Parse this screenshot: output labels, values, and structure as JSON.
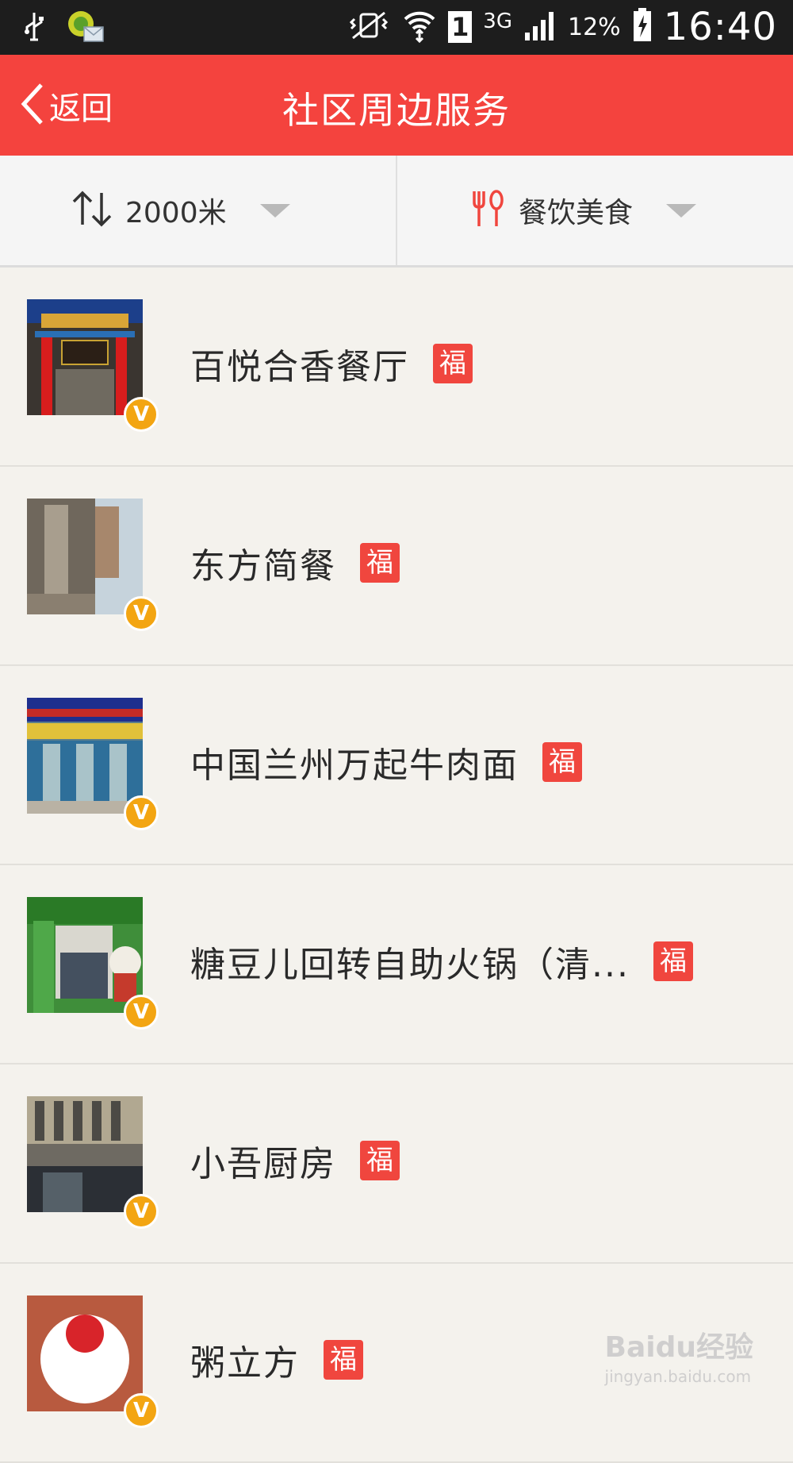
{
  "status_bar": {
    "sim_slot": "1",
    "network": "3G",
    "battery": "12%",
    "time": "16:40"
  },
  "header": {
    "back_label": "返回",
    "title": "社区周边服务"
  },
  "filters": {
    "distance": "2000米",
    "category": "餐饮美食"
  },
  "badges": {
    "fu": "福",
    "verified": "V"
  },
  "items": [
    {
      "name": "百悦合香餐厅"
    },
    {
      "name": "东方简餐"
    },
    {
      "name": "中国兰州万起牛肉面"
    },
    {
      "name": "糖豆儿回转自助火锅（清..."
    },
    {
      "name": "小吾厨房"
    },
    {
      "name": "粥立方"
    }
  ],
  "watermark": {
    "main": "Baidu经验",
    "sub": "jingyan.baidu.com"
  },
  "colors": {
    "header": "#f4433e",
    "fu_badge": "#f0463e",
    "verified_badge": "#f3a512"
  }
}
